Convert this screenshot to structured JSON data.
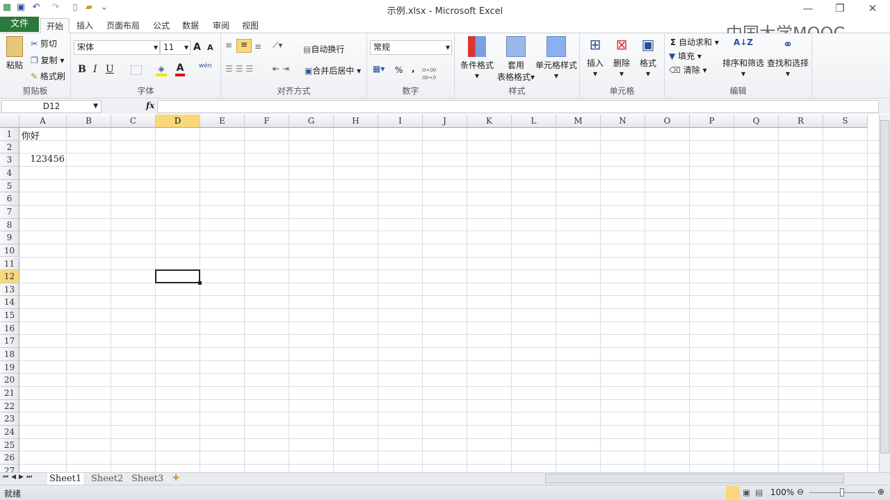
{
  "title": "示例.xlsx - Microsoft Excel",
  "quick_access": [
    "excel-logo-icon",
    "save-icon",
    "undo-icon",
    "redo-icon",
    "new-icon",
    "open-icon",
    "customize-icon"
  ],
  "watermark": "中国大学MOOC",
  "tabs": {
    "file": "文件",
    "items": [
      "开始",
      "插入",
      "页面布局",
      "公式",
      "数据",
      "审阅",
      "视图"
    ],
    "active": "开始"
  },
  "ribbon": {
    "clipboard": {
      "label": "剪贴板",
      "paste": "粘贴",
      "cut": "剪切",
      "copy": "复制",
      "format_painter": "格式刷"
    },
    "font": {
      "label": "字体",
      "font_name": "宋体",
      "font_size": "11",
      "bold": "B",
      "italic": "I",
      "underline": "U",
      "grow": "A",
      "shrink": "A",
      "font_color": "A",
      "phonetic": "wén"
    },
    "alignment": {
      "label": "对齐方式",
      "wrap": "自动换行",
      "merge": "合并后居中"
    },
    "number": {
      "label": "数字",
      "format": "常规",
      "percent": "%",
      "comma": ",",
      "inc_decimal": ".0→.00",
      "dec_decimal": ".00→.0"
    },
    "styles": {
      "label": "样式",
      "conditional": "条件格式",
      "table_line1": "套用",
      "table_line2": "表格格式",
      "cell_styles": "单元格样式"
    },
    "cells": {
      "label": "单元格",
      "insert": "插入",
      "delete": "删除",
      "format": "格式"
    },
    "editing": {
      "label": "编辑",
      "autosum": "自动求和",
      "fill": "填充",
      "clear": "清除",
      "sort": "排序和筛选",
      "find": "查找和选择"
    }
  },
  "formula_bar": {
    "name_box": "D12",
    "fx": "fx",
    "value": ""
  },
  "columns": [
    "A",
    "B",
    "C",
    "D",
    "E",
    "F",
    "G",
    "H",
    "I",
    "J",
    "K",
    "L",
    "M",
    "N",
    "O",
    "P",
    "Q",
    "R",
    "S"
  ],
  "rows": [
    "1",
    "2",
    "3",
    "4",
    "5",
    "6",
    "7",
    "8",
    "9",
    "10",
    "11",
    "12",
    "13",
    "14",
    "15",
    "16",
    "17",
    "18",
    "19",
    "20",
    "21",
    "22",
    "23",
    "24",
    "25",
    "26",
    "27"
  ],
  "selected_cell": {
    "col": "D",
    "row": "12"
  },
  "cells": {
    "A1": "你好",
    "A3": "123456"
  },
  "sheets": [
    "Sheet1",
    "Sheet2",
    "Sheet3"
  ],
  "active_sheet": "Sheet1",
  "status": {
    "text": "就绪",
    "zoom": "100%"
  }
}
